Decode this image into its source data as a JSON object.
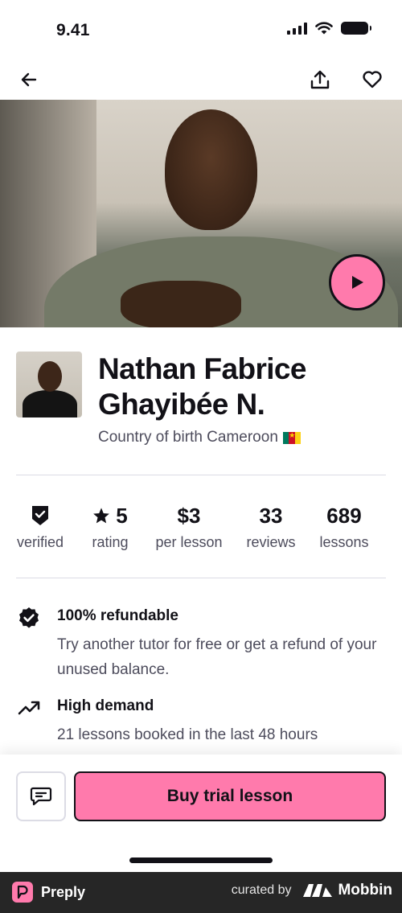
{
  "status_bar": {
    "time": "9.41"
  },
  "nav": {
    "back_icon": "arrow-left-icon",
    "share_icon": "share-upload-icon",
    "favorite_icon": "heart-icon"
  },
  "video": {
    "play_icon": "play-icon"
  },
  "profile": {
    "name": "Nathan Fabrice Ghayibée N.",
    "birth_label": "Country of birth Cameroon",
    "flag_colors": [
      "#007a5e",
      "#ce1126",
      "#fcd116"
    ]
  },
  "stats": [
    {
      "icon": "verified-shield-icon",
      "value": "",
      "label": "verified"
    },
    {
      "icon": "star-icon",
      "value": "5",
      "label": "rating"
    },
    {
      "value": "$3",
      "label": "per lesson"
    },
    {
      "value": "33",
      "label": "reviews"
    },
    {
      "value": "689",
      "label": "lessons"
    }
  ],
  "features": [
    {
      "icon": "badge-check-icon",
      "title": "100% refundable",
      "description": "Try another tutor for free or get a refund of your unused balance."
    },
    {
      "icon": "trending-up-icon",
      "title": "High demand",
      "description": "21 lessons booked in the last 48 hours"
    }
  ],
  "actions": {
    "message_icon": "message-icon",
    "trial_label": "Buy trial lesson"
  },
  "footer": {
    "brand": "Preply",
    "curated_by": "curated by",
    "curator": "Mobbin"
  },
  "colors": {
    "accent_pink": "#ff7aac",
    "text": "#121117",
    "muted": "#4d4c5c",
    "divider": "#dcdce5",
    "footer_bg": "#262626"
  }
}
